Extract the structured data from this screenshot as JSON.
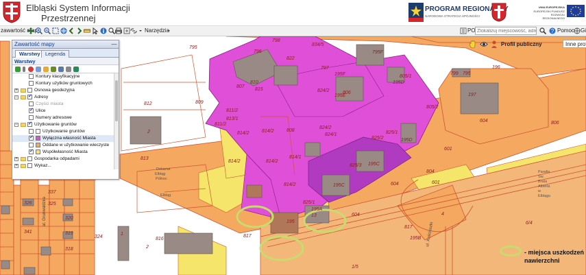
{
  "header": {
    "title_line1": "Elbląski System Informacji",
    "title_line2": "Przestrzennej",
    "program_logo_line1": "PROGRAM REGIONALNY",
    "program_logo_line2": "NARODOWA STRATEGIA SPÓJNOŚCI",
    "eu_line1": "UNIA EUROPEJSKA",
    "eu_line2": "EUROPEJSKI FUNDUSZ",
    "eu_line3": "ROZWOJU REGIONALNEGO"
  },
  "toolbar": {
    "content_button": "zawartość mapy",
    "tools_menu": "Narzędzia",
    "poi_label": "POI",
    "search_placeholder": "Zlokalizuj miejscowość, adres",
    "help_label": "Pomoc",
    "more_label": "Gis"
  },
  "panel": {
    "title": "Zawartość mapy",
    "tab_layers": "Warstwy",
    "tab_legend": "Legenda",
    "section_title": "Warstwy",
    "tree": [
      {
        "label": "Kontury klasyfikacyjne",
        "level": 2,
        "checked": false,
        "type": "leaf"
      },
      {
        "label": "Kontury użytków gruntowych",
        "level": 2,
        "checked": false,
        "type": "leaf"
      },
      {
        "label": "Osnowa geodezyjna",
        "level": 1,
        "checked": false,
        "type": "folder",
        "expanded": false
      },
      {
        "label": "Adresy",
        "level": 1,
        "checked": true,
        "type": "folder",
        "expanded": true
      },
      {
        "label": "Części miasta",
        "level": 2,
        "checked": false,
        "type": "leaf",
        "muted": true
      },
      {
        "label": "Ulice",
        "level": 2,
        "checked": true,
        "type": "leaf"
      },
      {
        "label": "Numery adresowe",
        "level": 2,
        "checked": false,
        "type": "leaf"
      },
      {
        "label": "Użytkowanie gruntów",
        "level": 1,
        "checked": true,
        "type": "folder",
        "expanded": true
      },
      {
        "label": "Użytkowanie gruntów",
        "level": 2,
        "checked": false,
        "type": "leaf",
        "swatch": "#ffffff"
      },
      {
        "label": "Wyłączna własność Miasta",
        "level": 2,
        "checked": true,
        "type": "leaf",
        "swatch": "#e04fd8",
        "selected": true
      },
      {
        "label": "Oddane w użytkowanie wieczyste",
        "level": 2,
        "checked": false,
        "type": "leaf",
        "swatch": "#f4a860"
      },
      {
        "label": "Współwłasność Miasta",
        "level": 2,
        "checked": true,
        "type": "leaf",
        "swatch": "#f5e56b"
      },
      {
        "label": "Gospodarka odpadami",
        "level": 1,
        "checked": false,
        "type": "folder",
        "expanded": false
      },
      {
        "label": "Wykaz...",
        "level": 1,
        "checked": false,
        "type": "folder",
        "expanded": false
      }
    ]
  },
  "map_bar": {
    "profile_label": "Profil publiczny",
    "other_profiles": "Inne profile"
  },
  "legend_note": {
    "text_line1": "- miejsca uszkodzeń",
    "text_line2": "nawierzchni"
  },
  "map": {
    "parcel_labels": [
      "795",
      "796",
      "798",
      "834/5",
      "822",
      "797",
      "795F",
      "805/1",
      "799",
      "795",
      "196",
      "807",
      "810",
      "815",
      "824/2",
      "806",
      "195F",
      "195D",
      "805/2",
      "197",
      "812",
      "809",
      "811/2",
      "813/1",
      "195E",
      "825/1",
      "195D",
      "808",
      "814/2",
      "814/1",
      "824/1",
      "825/2",
      "604",
      "2",
      "813",
      "814/2",
      "814/1",
      "825/3",
      "195C",
      "601",
      "806",
      "804",
      "604",
      "195C",
      "Parafia Św. Brata Alberta w Elbląg",
      "814/2",
      "825/1",
      "195A",
      "604",
      "6/4",
      "195",
      "13",
      "4",
      "1/5",
      "816",
      "817",
      "2",
      "324",
      "326",
      "325",
      "337",
      "320",
      "319",
      "318",
      "341",
      "817",
      "195B",
      "1"
    ],
    "street_labels": [
      "Dekanat Elbląg Północ",
      "Elbląg",
      "al. Grunwaldzka",
      "ul. Kościuszki"
    ],
    "colors": {
      "city_property": "#e04fd8",
      "perpetual_use": "#f4a860",
      "co_ownership": "#f5e56b",
      "building": "#9a8a86",
      "damage_marker": "#c6dd6e"
    }
  }
}
